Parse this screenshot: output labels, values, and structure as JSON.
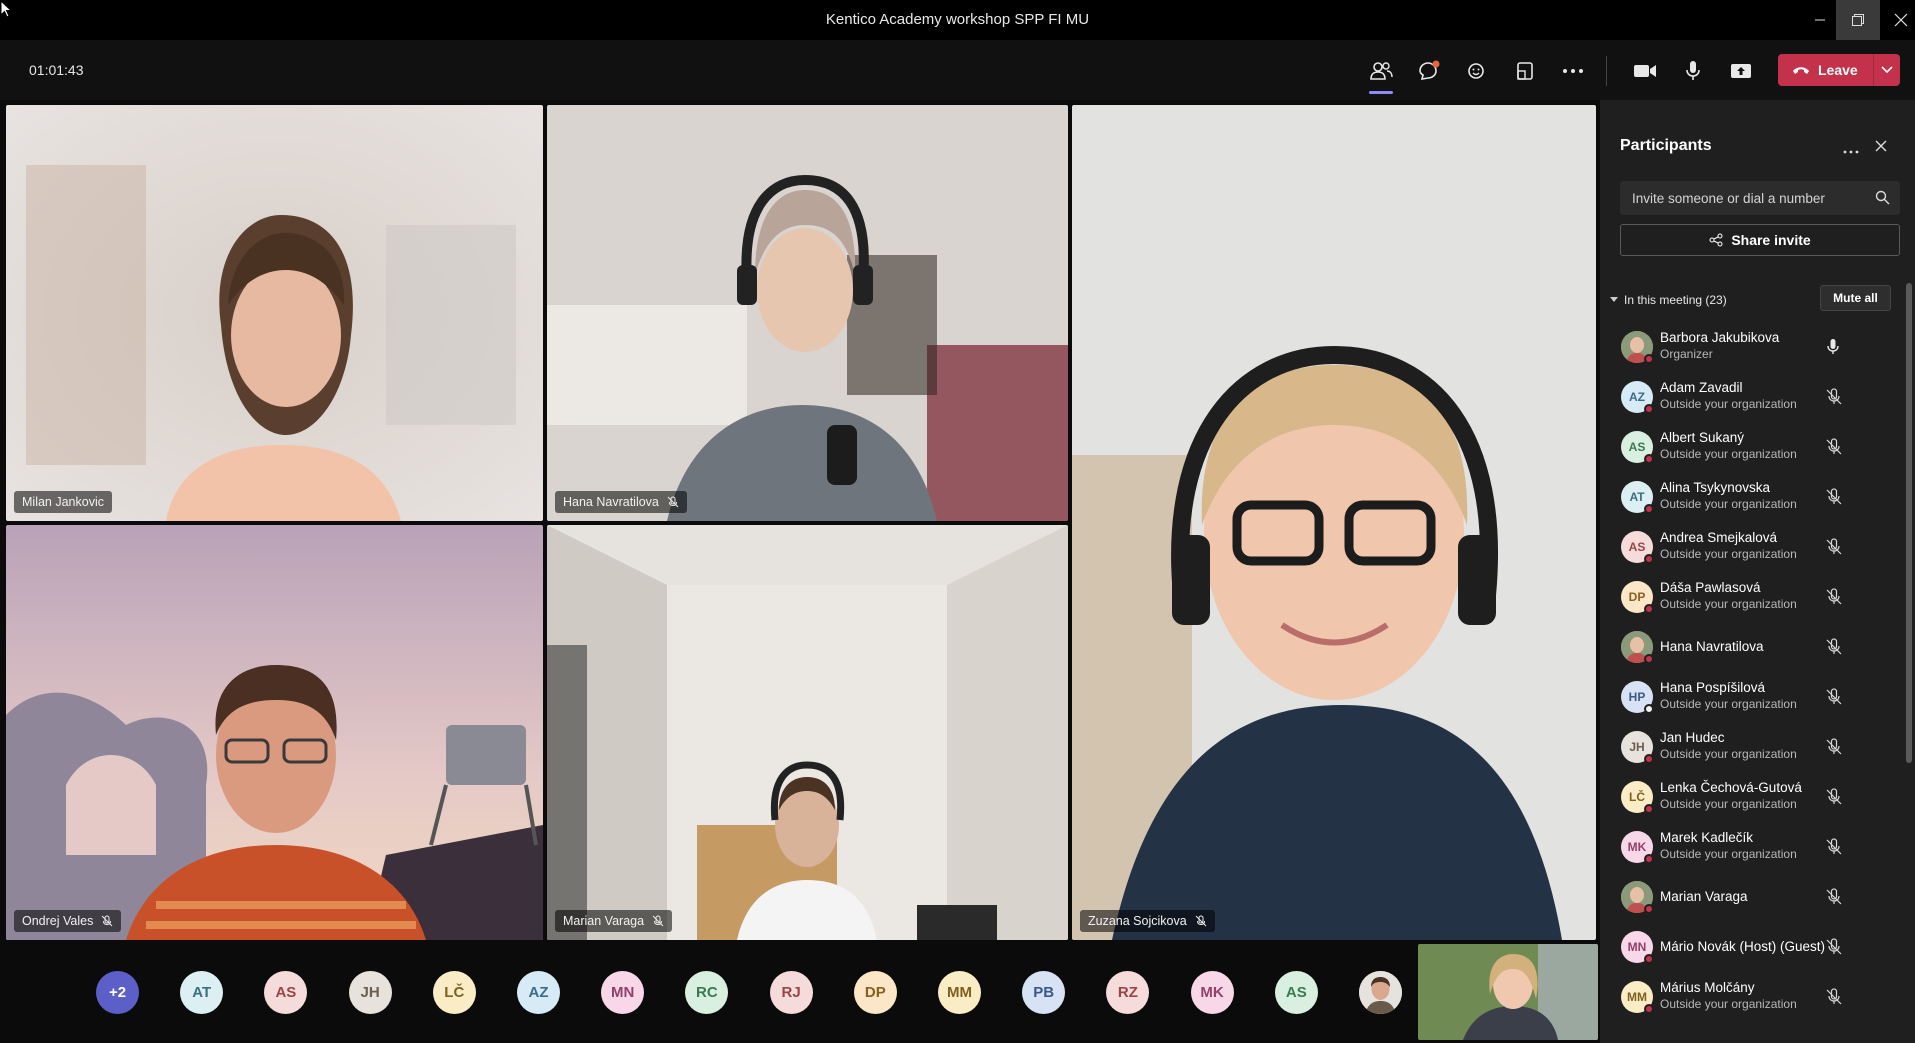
{
  "window": {
    "title": "Kentico Academy workshop SPP FI MU"
  },
  "toolbar": {
    "timer": "01:01:43",
    "leave_label": "Leave",
    "icons": [
      "participants-icon",
      "chat-icon",
      "reactions-icon",
      "share-tray-icon",
      "more-actions-icon",
      "camera-icon",
      "microphone-icon",
      "share-screen-icon",
      "phone-hangup-icon",
      "chevron-down-icon"
    ]
  },
  "tiles": [
    {
      "name": "Milan Jankovic",
      "muted": false
    },
    {
      "name": "Hana Navratilova",
      "muted": true
    },
    {
      "name": "Zuzana Sojcikova",
      "muted": true
    },
    {
      "name": "Ondrej Vales",
      "muted": true
    },
    {
      "name": "Marian Varaga",
      "muted": true
    }
  ],
  "panel": {
    "title": "Participants",
    "invite_placeholder": "Invite someone or dial a number",
    "share_invite_label": "Share invite",
    "section_label": "In this meeting (23)",
    "mute_all_label": "Mute all",
    "participants": [
      {
        "name": "Barbora Jakubikova",
        "sub": "Organizer",
        "initials": "",
        "photo": true,
        "mic": "on"
      },
      {
        "name": "Adam Zavadil",
        "sub": "Outside your organization",
        "initials": "AZ",
        "color": "#d7ebf6",
        "text": "#3d6a8a",
        "mic": "off"
      },
      {
        "name": "Albert Sukaný",
        "sub": "Outside your organization",
        "initials": "AS",
        "color": "#d9efe0",
        "text": "#3b7a52",
        "mic": "off"
      },
      {
        "name": "Alina Tsykynovska",
        "sub": "Outside your organization",
        "initials": "AT",
        "color": "#dceff3",
        "text": "#3a6f7e",
        "mic": "off"
      },
      {
        "name": "Andrea Smejkalová",
        "sub": "Outside your organization",
        "initials": "AS",
        "color": "#f6dbdb",
        "text": "#9a4545",
        "mic": "off"
      },
      {
        "name": "Dáša Pawlasová",
        "sub": "Outside your organization",
        "initials": "DP",
        "color": "#fbe6c8",
        "text": "#8a5f20",
        "mic": "off"
      },
      {
        "name": "Hana Navratilova",
        "sub": "",
        "initials": "",
        "photo": true,
        "mic": "off"
      },
      {
        "name": "Hana Pospíšilová",
        "sub": "Outside your organization",
        "initials": "HP",
        "color": "#d7e2f5",
        "text": "#3d5888",
        "mic": "off",
        "status": "away"
      },
      {
        "name": "Jan Hudec",
        "sub": "Outside your organization",
        "initials": "JH",
        "color": "#e8e2dc",
        "text": "#6b5d50",
        "mic": "off"
      },
      {
        "name": "Lenka Čechová-Gutová",
        "sub": "Outside your organization",
        "initials": "LČ",
        "color": "#faecc5",
        "text": "#806020",
        "mic": "off"
      },
      {
        "name": "Marek Kadlečík",
        "sub": "Outside your organization",
        "initials": "MK",
        "color": "#f8d7e8",
        "text": "#93406d",
        "mic": "off"
      },
      {
        "name": "Marian Varaga",
        "sub": "",
        "initials": "",
        "photo": true,
        "mic": "off"
      },
      {
        "name": "Mário Novák (Host) (Guest)",
        "sub": "",
        "initials": "MN",
        "color": "#f8d7e8",
        "text": "#93406d",
        "mic": "off"
      },
      {
        "name": "Márius Molčány",
        "sub": "Outside your organization",
        "initials": "MM",
        "color": "#faecc5",
        "text": "#806020",
        "mic": "off"
      }
    ]
  },
  "bottom_avatars": [
    {
      "initials": "+2",
      "color": "#5b5fc7",
      "text": "#ffffff"
    },
    {
      "initials": "AT",
      "color": "#dceff3",
      "text": "#3a6f7e"
    },
    {
      "initials": "AS",
      "color": "#f6dbdb",
      "text": "#9a4545"
    },
    {
      "initials": "JH",
      "color": "#e8e2dc",
      "text": "#6b5d50"
    },
    {
      "initials": "LČ",
      "color": "#faecc5",
      "text": "#806020"
    },
    {
      "initials": "AZ",
      "color": "#d7ebf6",
      "text": "#3d6a8a"
    },
    {
      "initials": "MN",
      "color": "#f8d7e8",
      "text": "#93406d"
    },
    {
      "initials": "RC",
      "color": "#d9efe0",
      "text": "#3b7a52"
    },
    {
      "initials": "RJ",
      "color": "#f6dbdb",
      "text": "#9a4545"
    },
    {
      "initials": "DP",
      "color": "#fbe6c8",
      "text": "#8a5f20"
    },
    {
      "initials": "MM",
      "color": "#faecc5",
      "text": "#806020"
    },
    {
      "initials": "PB",
      "color": "#d7e2f5",
      "text": "#3d5888"
    },
    {
      "initials": "RZ",
      "color": "#f6dbdb",
      "text": "#9a4545"
    },
    {
      "initials": "MK",
      "color": "#f8d7e8",
      "text": "#93406d"
    },
    {
      "initials": "AS",
      "color": "#d9efe0",
      "text": "#3b7a52"
    },
    {
      "initials": "",
      "color": "#c9b8a8",
      "text": "#ffffff",
      "photo": true
    }
  ]
}
